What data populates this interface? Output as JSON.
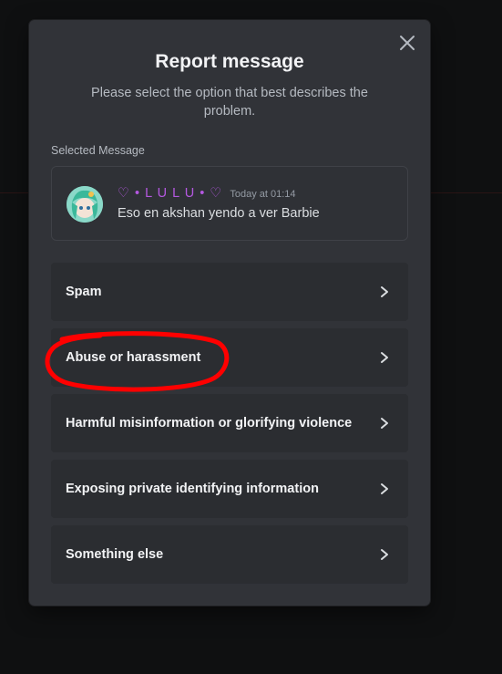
{
  "modal": {
    "title": "Report message",
    "subtitle": "Please select the option that best describes the problem.",
    "section_label": "Selected Message",
    "close_icon": "close-icon"
  },
  "message": {
    "username": "♡ • L U L U • ♡",
    "timestamp": "Today at 01:14",
    "text": "Eso en akshan yendo a ver Barbie"
  },
  "options": [
    {
      "label": "Spam"
    },
    {
      "label": "Abuse or harassment"
    },
    {
      "label": "Harmful misinformation or glorifying violence"
    },
    {
      "label": "Exposing private identifying information"
    },
    {
      "label": "Something else"
    }
  ],
  "colors": {
    "modal_bg": "#313338",
    "option_bg": "#2b2d31",
    "username": "#b458e0",
    "annotation": "#ff0000"
  }
}
